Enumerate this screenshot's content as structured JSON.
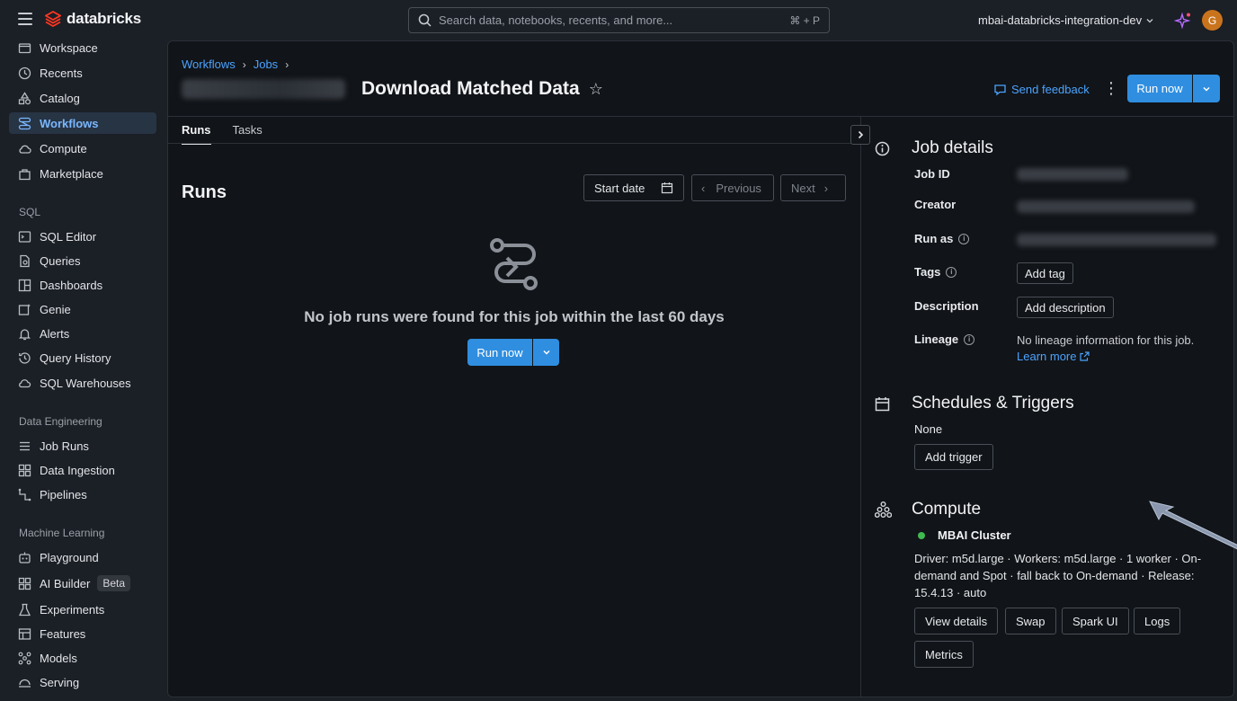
{
  "topbar": {
    "logo": "databricks",
    "search_placeholder": "Search data, notebooks, recents, and more...",
    "search_shortcut": "⌘ + P",
    "workspace": "mbai-databricks-integration-dev",
    "avatar_initial": "G"
  },
  "sidebar": {
    "items": [
      {
        "label": "Workspace"
      },
      {
        "label": "Recents"
      },
      {
        "label": "Catalog"
      },
      {
        "label": "Workflows"
      },
      {
        "label": "Compute"
      },
      {
        "label": "Marketplace"
      }
    ],
    "sql_section": "SQL",
    "sql_items": [
      {
        "label": "SQL Editor"
      },
      {
        "label": "Queries"
      },
      {
        "label": "Dashboards"
      },
      {
        "label": "Genie"
      },
      {
        "label": "Alerts"
      },
      {
        "label": "Query History"
      },
      {
        "label": "SQL Warehouses"
      }
    ],
    "de_section": "Data Engineering",
    "de_items": [
      {
        "label": "Job Runs"
      },
      {
        "label": "Data Ingestion"
      },
      {
        "label": "Pipelines"
      }
    ],
    "ml_section": "Machine Learning",
    "ml_items": [
      {
        "label": "Playground"
      },
      {
        "label": "AI Builder",
        "badge": "Beta"
      },
      {
        "label": "Experiments"
      },
      {
        "label": "Features"
      },
      {
        "label": "Models"
      },
      {
        "label": "Serving"
      }
    ]
  },
  "header": {
    "breadcrumbs": [
      "Workflows",
      "Jobs"
    ],
    "job_title": "Download Matched Data",
    "send_feedback": "Send feedback",
    "run_now": "Run now"
  },
  "tabs": [
    "Runs",
    "Tasks"
  ],
  "runs": {
    "heading": "Runs",
    "start_date": "Start date",
    "previous": "Previous",
    "next": "Next",
    "empty_message": "No job runs were found for this job within the last 60 days",
    "run_now": "Run now"
  },
  "job_details": {
    "title": "Job details",
    "job_id_label": "Job ID",
    "creator_label": "Creator",
    "run_as_label": "Run as",
    "tags_label": "Tags",
    "add_tag": "Add tag",
    "description_label": "Description",
    "add_description": "Add description",
    "lineage_label": "Lineage",
    "lineage_text": "No lineage information for this job.",
    "learn_more": "Learn more"
  },
  "schedules": {
    "title": "Schedules & Triggers",
    "value": "None",
    "add_trigger": "Add trigger"
  },
  "compute": {
    "title": "Compute",
    "cluster_name": "MBAI Cluster",
    "cluster_status_color": "#3fb950",
    "description": "Driver: m5d.large · Workers: m5d.large · 1 worker · On-demand and Spot · fall back to On-demand · Release: 15.4.13 · auto",
    "buttons": [
      "View details",
      "Swap",
      "Spark UI",
      "Logs",
      "Metrics"
    ]
  },
  "colors": {
    "accent": "#2f8ee0",
    "link": "#4ba3ff",
    "active_nav_bg": "#273444"
  }
}
